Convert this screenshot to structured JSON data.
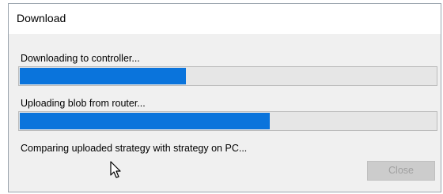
{
  "window": {
    "title": "Download"
  },
  "steps": [
    {
      "label": "Downloading to controller...",
      "progress": 0.4
    },
    {
      "label": "Uploading blob from router...",
      "progress": 0.6
    },
    {
      "label": "Comparing uploaded strategy with strategy on PC..."
    }
  ],
  "buttons": {
    "close_label": "Close",
    "close_enabled": false
  },
  "colors": {
    "progress_fill": "#0a74dc",
    "progress_track": "#e6e6e6"
  },
  "icons": [
    "mouse-pointer-icon"
  ]
}
